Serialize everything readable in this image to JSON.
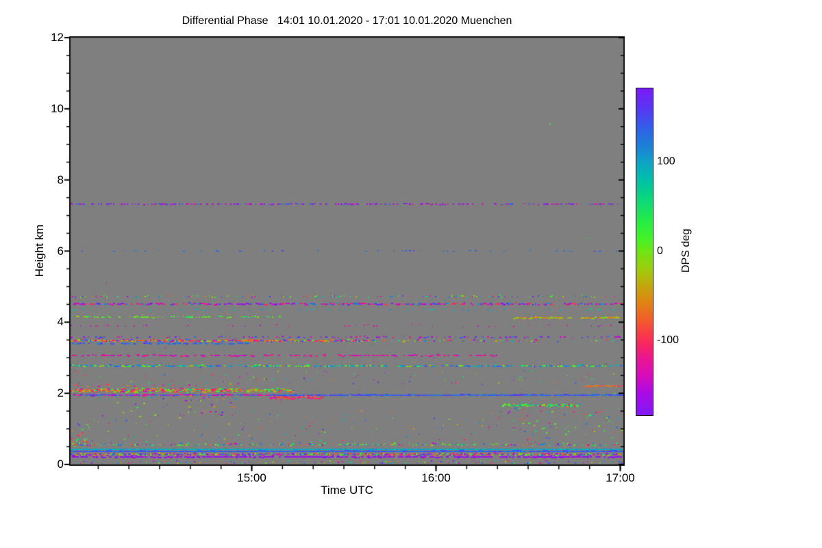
{
  "figure": {
    "title": "Differential Phase   14:01 10.01.2020 - 17:01 10.01.2020 Muenchen",
    "plot_background": "#7F7F7F",
    "page_background": "#ffffff"
  },
  "axes": {
    "x": {
      "label": "Time UTC",
      "start": "14:01",
      "end": "17:01",
      "span_min": 180,
      "minor_start_min": 9,
      "minor_step_min": 10,
      "ticks": [
        {
          "label": "15:00",
          "frac": 0.32778
        },
        {
          "label": "16:00",
          "frac": 0.66111
        },
        {
          "label": "17:00",
          "frac": 0.99444
        }
      ]
    },
    "y": {
      "label": "Height km",
      "min": 0,
      "max": 12,
      "minor_step_km": 0.5,
      "ticks": [
        {
          "label": "12",
          "km": 12
        },
        {
          "label": "10",
          "km": 10
        },
        {
          "label": "8",
          "km": 8
        },
        {
          "label": "6",
          "km": 6
        },
        {
          "label": "4",
          "km": 4
        },
        {
          "label": "2",
          "km": 2
        },
        {
          "label": "0",
          "km": 0
        }
      ]
    }
  },
  "colorbar": {
    "label": "DPS deg",
    "vmin": -183,
    "vmax": 183,
    "minor_step_deg": 10,
    "ticks": [
      {
        "label": "100",
        "value": 100
      },
      {
        "label": "0",
        "value": 0
      },
      {
        "label": "-100",
        "value": -100
      }
    ],
    "gradient": [
      {
        "f": 0.0,
        "c": "#7A1BF7"
      },
      {
        "f": 0.06,
        "c": "#5A35F2"
      },
      {
        "f": 0.125,
        "c": "#2F62E6"
      },
      {
        "f": 0.19,
        "c": "#1989D2"
      },
      {
        "f": 0.23,
        "c": "#0FA5C4"
      },
      {
        "f": 0.285,
        "c": "#00C2A4"
      },
      {
        "f": 0.34,
        "c": "#0BD97A"
      },
      {
        "f": 0.41,
        "c": "#27EC44"
      },
      {
        "f": 0.46,
        "c": "#45F128"
      },
      {
        "f": 0.5,
        "c": "#70E414"
      },
      {
        "f": 0.555,
        "c": "#9FCB0E"
      },
      {
        "f": 0.61,
        "c": "#C6A30F"
      },
      {
        "f": 0.65,
        "c": "#DC8812"
      },
      {
        "f": 0.71,
        "c": "#F15C2C"
      },
      {
        "f": 0.76,
        "c": "#FB3350"
      },
      {
        "f": 0.785,
        "c": "#F72562"
      },
      {
        "f": 0.825,
        "c": "#EC1690"
      },
      {
        "f": 0.875,
        "c": "#D90DB8"
      },
      {
        "f": 0.93,
        "c": "#AC0BE2"
      },
      {
        "f": 1.0,
        "c": "#8018F8"
      }
    ]
  },
  "chart_data": {
    "type": "heatmap",
    "title": "Differential Phase",
    "site": "Muenchen",
    "time_range_utc": [
      "14:01 10.01.2020",
      "17:01 10.01.2020"
    ],
    "xlabel": "Time UTC",
    "ylabel": "Height km",
    "value_label": "DPS deg",
    "value_range_deg": [
      -183,
      183
    ],
    "height_range_km": [
      0,
      12
    ],
    "background_value": "no-data (gray)",
    "seed": 20200110,
    "bands": [
      {
        "name": "line-7.3km",
        "h": 7.32,
        "spread": 0.025,
        "t": [
          0,
          1
        ],
        "density": 0.5,
        "burst": 1,
        "len": [
          1,
          3
        ],
        "values": [
          [
            115,
            175
          ],
          [
            -170,
            -115
          ],
          [
            -182,
            -150
          ]
        ]
      },
      {
        "name": "dots-6.0km",
        "h": 6.0,
        "spread": 0.03,
        "t": [
          0,
          1
        ],
        "density": 0.09,
        "burst": 1,
        "len": [
          1,
          3
        ],
        "values": [
          [
            115,
            160
          ]
        ]
      },
      {
        "name": "row-4.72km",
        "h": 4.72,
        "spread": 0.04,
        "t": [
          0,
          1
        ],
        "density": 0.3,
        "burst": 1,
        "len": [
          1,
          2
        ],
        "values": "uniform"
      },
      {
        "name": "band-4.51km",
        "h": 4.51,
        "spread": 0.035,
        "t": [
          0,
          1
        ],
        "density": 0.6,
        "burst": 1,
        "len": [
          2,
          4
        ],
        "values": [
          [
            100,
            180
          ],
          [
            -182,
            -130
          ],
          [
            -130,
            -90
          ]
        ]
      },
      {
        "name": "row-4.35km",
        "h": 4.35,
        "spread": 0.03,
        "t": [
          0,
          1
        ],
        "density": 0.15,
        "burst": 1,
        "len": [
          1,
          2
        ],
        "values": [
          [
            60,
            120
          ]
        ]
      },
      {
        "name": "line-4.15km-left",
        "h": 4.15,
        "spread": 0.03,
        "t": [
          0,
          0.38
        ],
        "density": 0.55,
        "burst": 1,
        "len": [
          1,
          3
        ],
        "values": [
          [
            -25,
            55
          ]
        ]
      },
      {
        "name": "line-4.12km-right",
        "h": 4.12,
        "spread": 0.03,
        "t": [
          0.8,
          1
        ],
        "density": 0.7,
        "burst": 1,
        "len": [
          2,
          4
        ],
        "values": [
          [
            -70,
            5
          ]
        ]
      },
      {
        "name": "row-3.9km",
        "h": 3.9,
        "spread": 0.04,
        "t": [
          0,
          1
        ],
        "density": 0.12,
        "burst": 1,
        "len": [
          1,
          2
        ],
        "values": [
          [
            -160,
            -115
          ]
        ]
      },
      {
        "name": "row-3.58km",
        "h": 3.58,
        "spread": 0.03,
        "t": [
          0,
          1
        ],
        "density": 0.3,
        "burst": 1,
        "len": [
          1,
          3
        ],
        "values": [
          [
            -175,
            -120
          ],
          [
            120,
            175
          ]
        ]
      },
      {
        "name": "band-3.48km-left",
        "h": 3.48,
        "spread": 0.035,
        "t": [
          0,
          0.55
        ],
        "density": 0.85,
        "burst": 2,
        "len": [
          2,
          4
        ],
        "values": [
          [
            -110,
            -40
          ],
          [
            -110,
            -40
          ],
          [
            -45,
            30
          ],
          [
            120,
            160
          ],
          [
            -155,
            -110
          ]
        ]
      },
      {
        "name": "band-3.48km-right",
        "h": 3.48,
        "spread": 0.035,
        "t": [
          0.55,
          1
        ],
        "density": 0.25,
        "burst": 1,
        "len": [
          1,
          3
        ],
        "values": "uniform"
      },
      {
        "name": "line-3.4km-blue",
        "h": 3.4,
        "spread": 0.02,
        "t": [
          0,
          0.32
        ],
        "density": 0.5,
        "burst": 1,
        "len": [
          2,
          4
        ],
        "values": [
          [
            110,
            160
          ]
        ]
      },
      {
        "name": "line-3.06km",
        "h": 3.06,
        "spread": 0.022,
        "t": [
          0,
          0.78
        ],
        "density": 0.35,
        "burst": 1,
        "len": [
          2,
          5
        ],
        "values": [
          [
            -150,
            -112
          ]
        ]
      },
      {
        "name": "band-2.77km",
        "h": 2.77,
        "spread": 0.035,
        "t": [
          0,
          1
        ],
        "density": 0.6,
        "burst": 1,
        "len": [
          2,
          5
        ],
        "values": [
          [
            80,
            150
          ],
          [
            80,
            150
          ],
          [
            -40,
            40
          ]
        ]
      },
      {
        "name": "field-2.3-2.6km",
        "hrange": [
          2.25,
          2.65
        ],
        "t": [
          0,
          1
        ],
        "density": 0.2,
        "burst": 1,
        "len": [
          1,
          2
        ],
        "values": "uniform"
      },
      {
        "name": "band-2.08km-left",
        "h": 2.08,
        "spread": 0.075,
        "t": [
          0,
          0.4
        ],
        "density": 0.97,
        "burst": 3,
        "len": [
          2,
          4
        ],
        "values": [
          [
            -105,
            -35
          ],
          [
            -105,
            -35
          ],
          [
            -140,
            -100
          ],
          [
            -35,
            25
          ],
          [
            25,
            80
          ]
        ]
      },
      {
        "name": "spikes-2.2km",
        "h": 2.22,
        "spread": 0.1,
        "t": [
          0,
          0.3
        ],
        "density": 0.25,
        "burst": 1,
        "len": [
          1,
          3
        ],
        "values": [
          [
            -105,
            -35
          ],
          [
            -140,
            -100
          ]
        ]
      },
      {
        "name": "line-1.95km-left",
        "h": 1.95,
        "spread": 0.02,
        "t": [
          0,
          0.37
        ],
        "density": 0.7,
        "burst": 1,
        "len": [
          2,
          5
        ],
        "values": [
          [
            115,
            165
          ],
          [
            -150,
            -110
          ]
        ]
      },
      {
        "name": "line-1.95km-right",
        "h": 1.95,
        "spread": 0.015,
        "t": [
          0.37,
          1
        ],
        "density": 0.8,
        "burst": 1,
        "len": [
          3,
          7
        ],
        "values": [
          [
            115,
            165
          ]
        ]
      },
      {
        "name": "blob-1.88km",
        "h": 1.88,
        "spread": 0.07,
        "t": [
          0.36,
          0.455
        ],
        "density": 0.9,
        "burst": 2,
        "len": [
          2,
          4
        ],
        "values": [
          [
            -140,
            -80
          ],
          [
            -110,
            -60
          ]
        ]
      },
      {
        "name": "tail-under-2km",
        "hrange": [
          1.1,
          1.95
        ],
        "t": [
          0.02,
          0.33
        ],
        "density": 0.35,
        "burst": 1,
        "len": [
          1,
          3
        ],
        "values": "uniform"
      },
      {
        "name": "tail-cluster",
        "hrange": [
          1.35,
          1.95
        ],
        "t": [
          0.19,
          0.29
        ],
        "density": 0.5,
        "burst": 1,
        "len": [
          1,
          3
        ],
        "values": [
          [
            -140,
            -60
          ],
          [
            -40,
            40
          ],
          [
            -182,
            -150
          ]
        ]
      },
      {
        "name": "band-1.66km-right",
        "h": 1.66,
        "spread": 0.055,
        "t": [
          0.78,
          0.92
        ],
        "density": 0.9,
        "burst": 2,
        "len": [
          2,
          4
        ],
        "values": [
          [
            -15,
            60
          ],
          [
            80,
            135
          ],
          [
            -140,
            -60
          ],
          [
            -15,
            60
          ]
        ]
      },
      {
        "name": "orange-2.2km-right",
        "h": 2.2,
        "spread": 0.035,
        "t": [
          0.925,
          1
        ],
        "density": 0.7,
        "burst": 1,
        "len": [
          2,
          4
        ],
        "values": [
          [
            -95,
            -45
          ]
        ]
      },
      {
        "name": "field-low-sparse",
        "hrange": [
          0.62,
          1.5
        ],
        "t": [
          0,
          1
        ],
        "density": 0.3,
        "burst": 1,
        "len": [
          1,
          2
        ],
        "values": "uniform"
      },
      {
        "name": "cluster-right-low",
        "hrange": [
          0.85,
          1.6
        ],
        "t": [
          0.8,
          1
        ],
        "density": 0.45,
        "burst": 1,
        "len": [
          1,
          3
        ],
        "values": [
          [
            -20,
            55
          ],
          [
            -20,
            55
          ],
          [
            -140,
            -70
          ],
          [
            90,
            140
          ]
        ]
      },
      {
        "name": "corner-left-low",
        "hrange": [
          0.45,
          0.98
        ],
        "t": [
          0,
          0.028
        ],
        "density": 0.85,
        "burst": 2,
        "len": [
          2,
          3
        ],
        "values": [
          [
            -115,
            -30
          ],
          [
            -5,
            60
          ]
        ]
      },
      {
        "name": "band-0.56km",
        "h": 0.56,
        "spread": 0.045,
        "t": [
          0,
          1
        ],
        "density": 0.5,
        "burst": 1,
        "len": [
          1,
          3
        ],
        "values": [
          [
            -15,
            55
          ],
          [
            -15,
            55
          ],
          [
            -120,
            -60
          ],
          [
            95,
            140
          ],
          [
            -170,
            -140
          ]
        ]
      },
      {
        "name": "cyan-line-0.42km",
        "h": 0.425,
        "spread": 0.008,
        "t": [
          0,
          1
        ],
        "density": 0.97,
        "burst": 1,
        "len": [
          5,
          10
        ],
        "values": [
          [
            85,
            108
          ]
        ]
      },
      {
        "name": "blue-line-0.37km",
        "h": 0.372,
        "spread": 0.008,
        "t": [
          0,
          1
        ],
        "density": 0.9,
        "burst": 1,
        "len": [
          4,
          9
        ],
        "values": [
          [
            122,
            158
          ]
        ]
      },
      {
        "name": "band-0.28km",
        "h": 0.28,
        "spread": 0.05,
        "t": [
          0,
          1
        ],
        "density": 0.95,
        "burst": 2,
        "len": [
          1,
          3
        ],
        "values": [
          [
            -140,
            -30
          ],
          [
            -140,
            -30
          ],
          [
            -20,
            45
          ],
          [
            100,
            170
          ],
          [
            -182,
            -150
          ]
        ]
      },
      {
        "name": "purple-line-0.2km",
        "h": 0.205,
        "spread": 0.01,
        "t": [
          0,
          1
        ],
        "density": 0.6,
        "burst": 1,
        "len": [
          2,
          5
        ],
        "values": [
          [
            -182,
            -155
          ]
        ]
      },
      {
        "name": "bottom-edge",
        "hrange": [
          0.02,
          0.1
        ],
        "t": [
          0,
          1
        ],
        "density": 0.3,
        "burst": 1,
        "len": [
          1,
          2
        ],
        "values": "uniform"
      },
      {
        "name": "field-general",
        "hrange": [
          0.1,
          4.72
        ],
        "t": [
          0,
          1
        ],
        "density": 0.07,
        "burst": 1,
        "len": [
          1,
          1
        ],
        "values": "uniform"
      },
      {
        "name": "field-mid-rare",
        "hrange": [
          4.75,
          6.4
        ],
        "t": [
          0,
          1
        ],
        "density": 0.012,
        "burst": 1,
        "len": [
          1,
          1
        ],
        "values": "uniform"
      }
    ],
    "isolated_dots": [
      {
        "t": 0.866,
        "h": 9.58,
        "v": 35
      }
    ]
  }
}
